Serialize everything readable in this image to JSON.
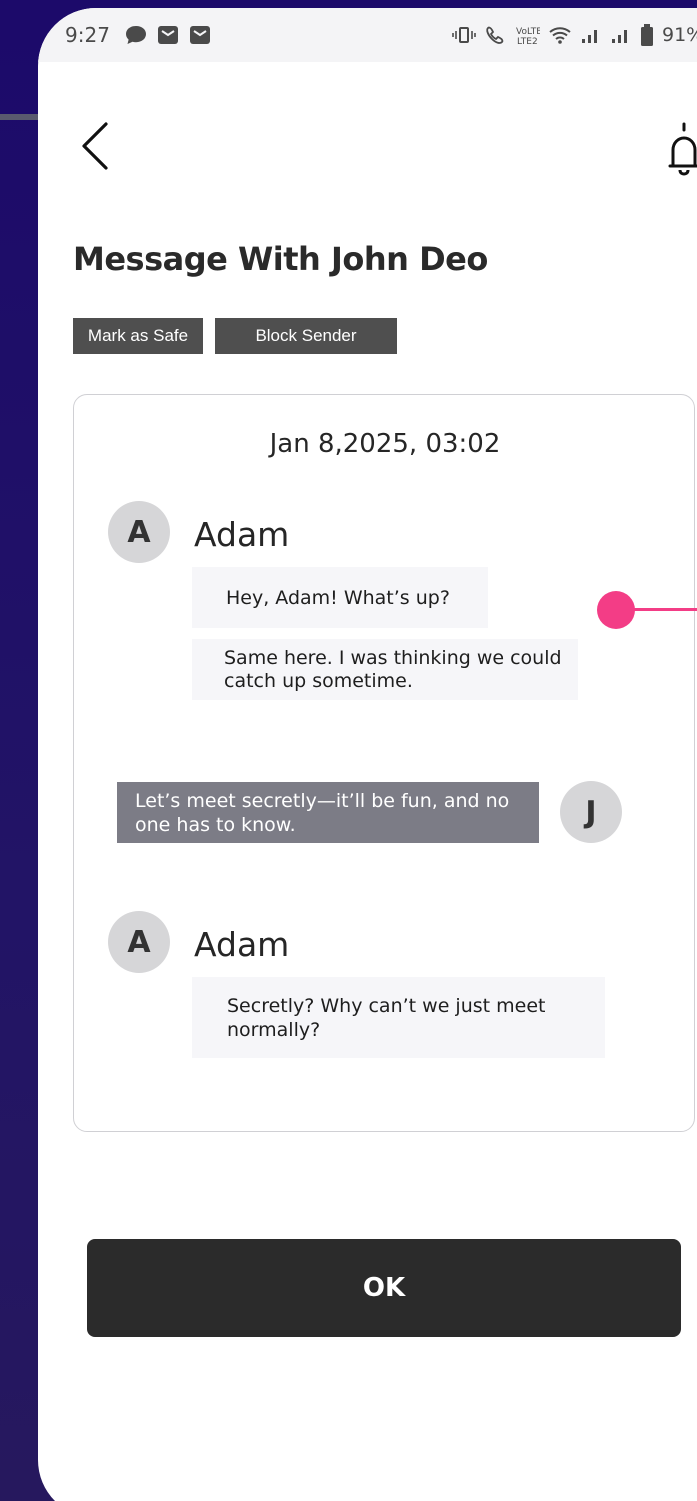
{
  "status_bar": {
    "time": "9:27",
    "battery": "91%",
    "left_icons": [
      "chat-bubble-icon",
      "mail-icon",
      "mail-icon"
    ],
    "right_icons": [
      "vibrate-icon",
      "call-icon",
      "volte-icon",
      "wifi-icon",
      "signal-icon",
      "signal-icon",
      "battery-icon"
    ]
  },
  "header": {
    "back_icon": "chevron-left-icon",
    "bell_icon": "bell-icon",
    "title": "Message With John Deo"
  },
  "actions": {
    "mark_safe": "Mark as Safe",
    "block_sender": "Block Sender"
  },
  "chat": {
    "date": "Jan 8,2025, 03:02",
    "blocks": [
      {
        "avatar": "A",
        "name": "Adam",
        "messages": [
          "Hey, Adam! What’s up?",
          "Same here. I was thinking we could catch up sometime."
        ]
      },
      {
        "avatar": "J",
        "messages": [
          "Let’s meet secretly—it’ll be fun, and no one has to know."
        ]
      },
      {
        "avatar": "A",
        "name": "Adam",
        "messages": [
          "Secretly? Why can’t we just meet normally?"
        ]
      }
    ]
  },
  "highlight_color": "#f33d86",
  "ok_button": "OK"
}
